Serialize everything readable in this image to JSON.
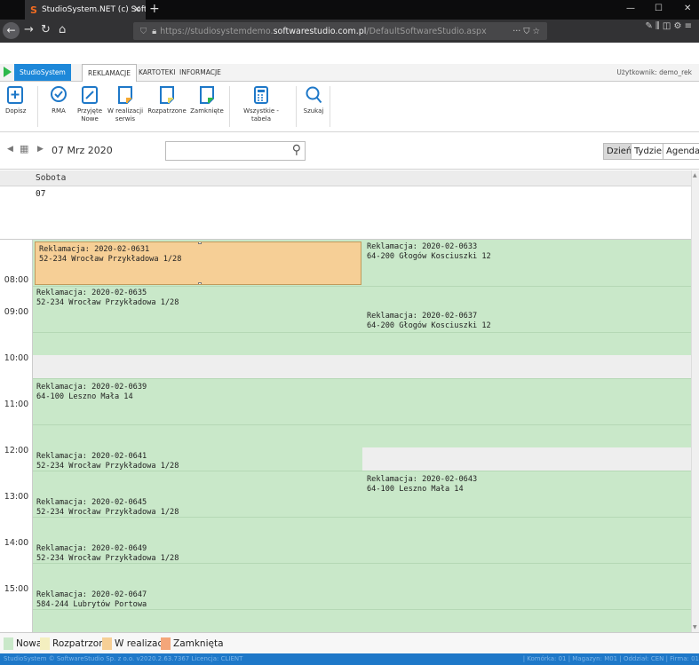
{
  "browser": {
    "tab_title": "StudioSystem.NET (c) Software",
    "url_prefix": "https://studiosystemdemo.",
    "url_domain": "softwarestudio.com.pl",
    "url_path": "/DefaultSoftwareStudio.aspx"
  },
  "app": {
    "brand": "StudioSystem",
    "tabs": [
      "REKLAMACJE",
      "KARTOTEKI",
      "INFORMACJE"
    ],
    "user_label": "Użytkownik: demo_rek"
  },
  "ribbon": {
    "add": "Dopisz",
    "rma": "RMA",
    "new_line1": "Przyjęte",
    "new_line2": "Nowe",
    "inprogress_line1": "W realizacji",
    "inprogress_line2": "serwis",
    "considered": "Rozpatrzone",
    "closed": "Zamknięte",
    "all_table": "Wszystkie - tabela",
    "search": "Szukaj"
  },
  "datenav": {
    "date": "07 Mrz 2020",
    "views": [
      "Dzień",
      "Tydzień",
      "Agenda"
    ]
  },
  "calendar": {
    "day_name": "Sobota",
    "day_number": "07",
    "hours": [
      "08:00",
      "09:00",
      "10:00",
      "11:00",
      "12:00",
      "13:00",
      "14:00",
      "15:00"
    ],
    "events": [
      {
        "title": "Reklamacja: 2020-02-0631",
        "address": "52-234 Wrocław Przykładowa 1/28"
      },
      {
        "title": "Reklamacja: 2020-02-0633",
        "address": "64-200 Głogów Kosciuszki 12"
      },
      {
        "title": "Reklamacja: 2020-02-0635",
        "address": "52-234 Wrocław Przykładowa 1/28"
      },
      {
        "title": "Reklamacja: 2020-02-0637",
        "address": "64-200 Głogów Kosciuszki 12"
      },
      {
        "title": "Reklamacja: 2020-02-0639",
        "address": "64-100 Leszno Mała 14"
      },
      {
        "title": "Reklamacja: 2020-02-0641",
        "address": "52-234 Wrocław Przykładowa 1/28"
      },
      {
        "title": "Reklamacja: 2020-02-0643",
        "address": "64-100 Leszno Mała 14"
      },
      {
        "title": "Reklamacja: 2020-02-0645",
        "address": "52-234 Wrocław Przykładowa 1/28"
      },
      {
        "title": "Reklamacja: 2020-02-0649",
        "address": "52-234 Wrocław Przykładowa 1/28"
      },
      {
        "title": "Reklamacja: 2020-02-0647",
        "address": "584-244 Lubrytów Portowa"
      }
    ]
  },
  "legend": [
    {
      "label": "Nowa",
      "color": "#c9e8c9"
    },
    {
      "label": "Rozpatrzona",
      "color": "#f4efc0"
    },
    {
      "label": "W realizacji",
      "color": "#f6cf96"
    },
    {
      "label": "Zamknięta",
      "color": "#f4a67a"
    }
  ],
  "footer": {
    "left": "StudioSystem © SoftwareStudio Sp. z o.o.  v2020.2.63.7367  Licencja: CLIENT",
    "right": "| Komórka: 01 | Magazyn: M01 | Oddział: CEN | Firma: 01"
  }
}
